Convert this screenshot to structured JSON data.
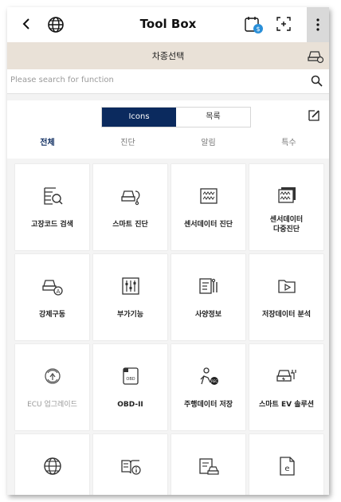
{
  "header": {
    "title": "Tool Box",
    "icons": [
      "back-chevron-icon",
      "globe-icon",
      "calendar-badge-icon",
      "scan-frame-icon",
      "more-vertical-icon"
    ]
  },
  "vehicle_bar": {
    "label": "차종선택",
    "icon": "car-settings-icon"
  },
  "search": {
    "placeholder": "Please search for function",
    "icon": "search-icon"
  },
  "view_toggle": {
    "options": [
      "Icons",
      "목록"
    ],
    "selected": "Icons",
    "edit_icon": "edit-icon"
  },
  "tabs": [
    {
      "label": "전체",
      "active": true
    },
    {
      "label": "진단",
      "active": false
    },
    {
      "label": "알림",
      "active": false
    },
    {
      "label": "특수",
      "active": false
    }
  ],
  "tiles": [
    {
      "label": "고장코드 검색",
      "icon": "dtc-search-icon"
    },
    {
      "label": "스마트 진단",
      "icon": "smart-diagnosis-icon"
    },
    {
      "label": "센서데이터 진단",
      "icon": "sensor-data-icon"
    },
    {
      "label": "센서데이터\n다중진단",
      "icon": "multi-sensor-data-icon"
    },
    {
      "label": "강제구동",
      "icon": "forced-drive-icon"
    },
    {
      "label": "부가기능",
      "icon": "sliders-icon"
    },
    {
      "label": "사양정보",
      "icon": "specification-icon"
    },
    {
      "label": "저장데이터 분석",
      "icon": "folder-play-icon"
    },
    {
      "label": "ECU 업그레이드",
      "icon": "ecu-upgrade-icon",
      "disabled": true
    },
    {
      "label": "OBD-II",
      "icon": "obd-icon"
    },
    {
      "label": "주행데이터 저장",
      "icon": "driving-data-record-icon"
    },
    {
      "label": "스마트 EV 솔루션",
      "icon": "ev-charging-icon"
    },
    {
      "label": "",
      "icon": "globe-icon"
    },
    {
      "label": "",
      "icon": "manual-info-icon"
    },
    {
      "label": "",
      "icon": "vehicle-document-icon"
    },
    {
      "label": "",
      "icon": "e-document-icon"
    }
  ],
  "colors": {
    "accent": "#0b2a5e",
    "vehicle_bar": "#e9e1d7",
    "grid_background": "#f4f4f4"
  }
}
